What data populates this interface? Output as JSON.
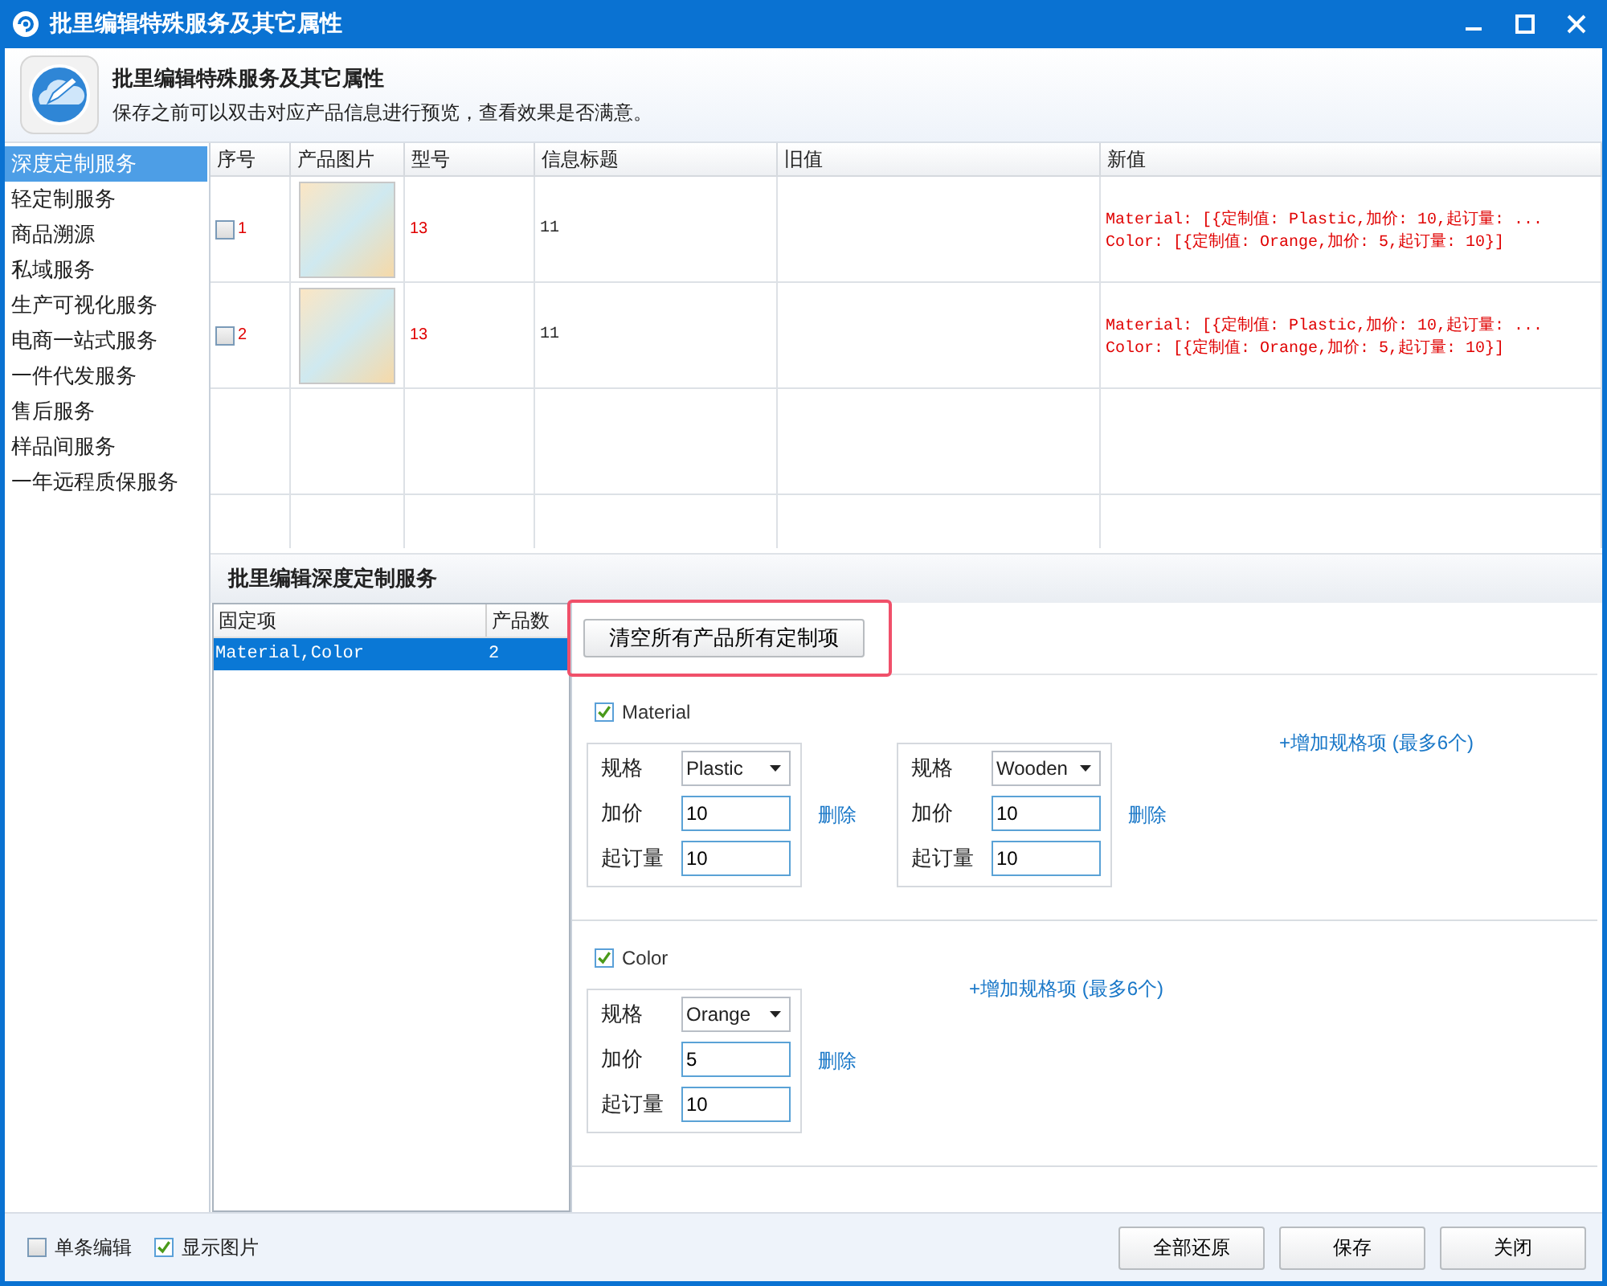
{
  "window": {
    "title": "批里编辑特殊服务及其它属性"
  },
  "header": {
    "title": "批里编辑特殊服务及其它属性",
    "subtitle": "保存之前可以双击对应产品信息进行预览，查看效果是否满意。"
  },
  "sidebar": {
    "items": [
      {
        "label": "深度定制服务",
        "selected": true
      },
      {
        "label": "轻定制服务",
        "selected": false
      },
      {
        "label": "商品溯源",
        "selected": false
      },
      {
        "label": "私域服务",
        "selected": false
      },
      {
        "label": "生产可视化服务",
        "selected": false
      },
      {
        "label": "电商一站式服务",
        "selected": false
      },
      {
        "label": "一件代发服务",
        "selected": false
      },
      {
        "label": "售后服务",
        "selected": false
      },
      {
        "label": "样品间服务",
        "selected": false
      },
      {
        "label": "一年远程质保服务",
        "selected": false
      }
    ]
  },
  "table": {
    "columns": [
      "序号",
      "产品图片",
      "型号",
      "信息标题",
      "旧值",
      "新值"
    ],
    "rows": [
      {
        "checked": false,
        "index": "1",
        "model": "13",
        "title": "11",
        "new_value": [
          "Material: [{定制值: Plastic,加价: 10,起订量: ...",
          "Color: [{定制值: Orange,加价: 5,起订量: 10}]"
        ]
      },
      {
        "checked": false,
        "index": "2",
        "model": "13",
        "title": "11",
        "new_value": [
          "Material: [{定制值: Plastic,加价: 10,起订量: ...",
          "Color: [{定制值: Orange,加价: 5,起订量: 10}]"
        ]
      }
    ]
  },
  "section_title": "批里编辑深度定制服务",
  "fixed_items": {
    "columns": [
      "固定项",
      "产品数"
    ],
    "rows": [
      {
        "name": "Material,Color",
        "count": "2",
        "selected": true
      }
    ]
  },
  "customization": {
    "clear_button": "清空所有产品所有定制项",
    "groups": [
      {
        "name": "Material",
        "checked": true,
        "add_link": "+增加规格项 (最多6个)",
        "specs": [
          {
            "fields": [
              {
                "kind": "select",
                "label": "规格",
                "value": "Plastic"
              },
              {
                "kind": "input",
                "label": "加价",
                "value": "10"
              },
              {
                "kind": "input",
                "label": "起订量",
                "value": "10"
              }
            ],
            "delete": "删除"
          },
          {
            "fields": [
              {
                "kind": "select",
                "label": "规格",
                "value": "Wooden"
              },
              {
                "kind": "input",
                "label": "加价",
                "value": "10"
              },
              {
                "kind": "input",
                "label": "起订量",
                "value": "10"
              }
            ],
            "delete": "删除"
          }
        ]
      },
      {
        "name": "Color",
        "checked": true,
        "add_link": "+增加规格项 (最多6个)",
        "specs": [
          {
            "fields": [
              {
                "kind": "select",
                "label": "规格",
                "value": "Orange"
              },
              {
                "kind": "input",
                "label": "加价",
                "value": "5"
              },
              {
                "kind": "input",
                "label": "起订量",
                "value": "10"
              }
            ],
            "delete": "删除"
          }
        ]
      }
    ]
  },
  "footer": {
    "options": [
      {
        "label": "单条编辑",
        "checked": false
      },
      {
        "label": "显示图片",
        "checked": true
      }
    ],
    "buttons": [
      "全部还原",
      "保存",
      "关闭"
    ]
  }
}
